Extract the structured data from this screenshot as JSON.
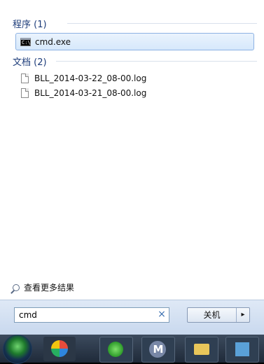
{
  "programs": {
    "title": "程序 (1)",
    "items": [
      {
        "label": "cmd.exe",
        "icon": "cmd-icon"
      }
    ]
  },
  "documents": {
    "title": "文档 (2)",
    "items": [
      {
        "label": "BLL_2014-03-22_08-00.log",
        "icon": "document-icon"
      },
      {
        "label": "BLL_2014-03-21_08-00.log",
        "icon": "document-icon"
      }
    ]
  },
  "see_more": {
    "label": "查看更多结果"
  },
  "search": {
    "value": "cmd",
    "clear": "×"
  },
  "shutdown": {
    "label": "关机",
    "arrow": "▸"
  },
  "cmd_icon_text": "C:\\",
  "taskbar": {
    "m_label": "M"
  }
}
